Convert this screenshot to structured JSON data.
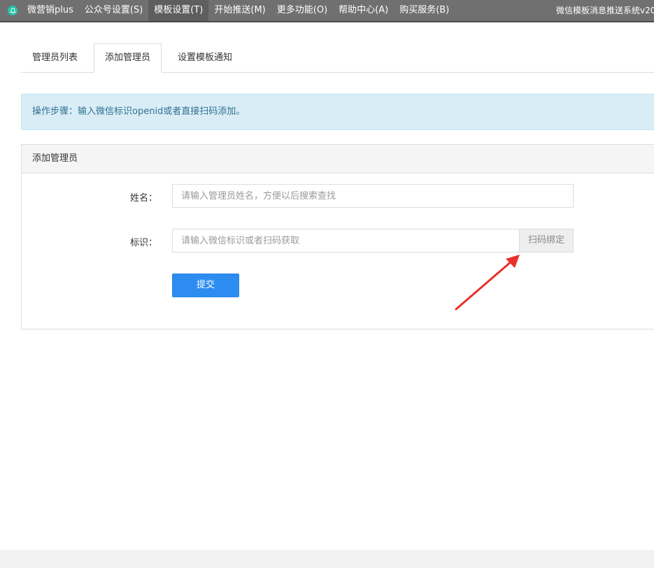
{
  "menubar": {
    "items": [
      {
        "label": "微营销plus"
      },
      {
        "label": "公众号设置(S)"
      },
      {
        "label": "模板设置(T)"
      },
      {
        "label": "开始推送(M)"
      },
      {
        "label": "更多功能(O)"
      },
      {
        "label": "帮助中心(A)"
      },
      {
        "label": "购买服务(B)"
      }
    ],
    "active_index": 2,
    "system_title": "微信模板消息推送系统v20",
    "app_icon": "bell-icon"
  },
  "tabs": [
    {
      "label": "管理员列表"
    },
    {
      "label": "添加管理员"
    },
    {
      "label": "设置模板通知"
    }
  ],
  "active_tab": 1,
  "alert": {
    "text": "操作步骤：输入微信标识openid或者直接扫码添加。"
  },
  "panel": {
    "title": "添加管理员",
    "name_label": "姓名：",
    "name_placeholder": "请输入管理员姓名，方便以后搜索查找",
    "name_value": "",
    "id_label": "标识：",
    "id_placeholder": "请输入微信标识或者扫码获取",
    "id_value": "",
    "scan_button": "扫码绑定",
    "submit_button": "提交"
  },
  "colors": {
    "menubar_bg": "#707070",
    "accent_blue": "#2d8cf0",
    "alert_bg": "#d9edf7",
    "alert_text": "#31708f",
    "annotation_arrow": "#e8312a"
  }
}
